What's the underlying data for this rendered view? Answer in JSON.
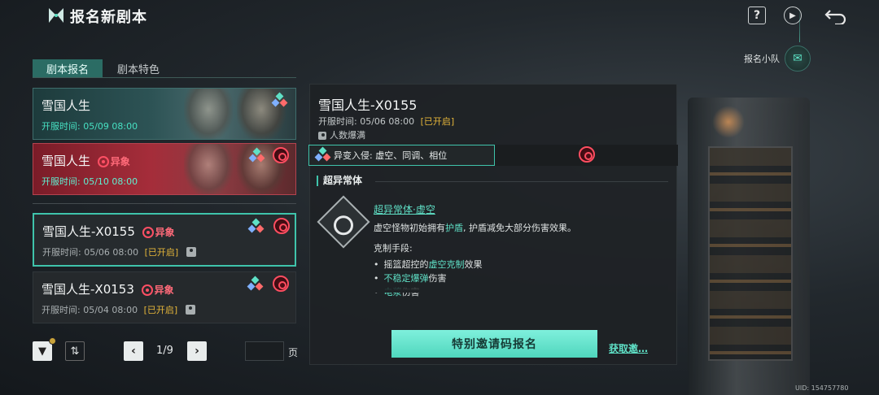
{
  "header": {
    "title": "报名新剧本",
    "help_label": "?",
    "team_label": "报名小队"
  },
  "tabs": [
    {
      "label": "剧本报名",
      "active": true
    },
    {
      "label": "剧本特色",
      "active": false
    }
  ],
  "list": [
    {
      "name": "雪国人生",
      "time": "开服时间: 05/09 08:00",
      "anomaly": "",
      "status": ""
    },
    {
      "name": "雪国人生",
      "time": "开服时间: 05/10 08:00",
      "anomaly": "异象",
      "status": ""
    },
    {
      "name": "雪国人生-X0155",
      "time": "开服时间: 05/06 08:00",
      "anomaly": "异象",
      "status": "[已开启]"
    },
    {
      "name": "雪国人生-X0153",
      "time": "开服时间: 05/04 08:00",
      "anomaly": "异象",
      "status": "[已开启]"
    }
  ],
  "pagination": {
    "indicator": "1/9",
    "page_input": "",
    "unit": "页"
  },
  "detail": {
    "title": "雪国人生-X0155",
    "time": "开服时间: 05/06 08:00",
    "status": "[已开启]",
    "population": "人数爆满",
    "mutation": "异变入侵: 虚空、同调、相位",
    "section_title": "超异常体",
    "ability_name": "超异常体·虚空",
    "ability_desc_pre": "虚空怪物初始拥有",
    "ability_desc_hl": "护盾",
    "ability_desc_post": ", 护盾减免大部分伤害效果。",
    "counter_title": "克制手段:",
    "counter_1_pre": "摇篮超控的",
    "counter_1_hl": "虚空克制",
    "counter_1_post": "效果",
    "counter_2_hl": "不稳定爆弹",
    "counter_2_post": "伤害",
    "counter_3_hl": "电浆",
    "counter_3_post": "伤害",
    "invite_button": "特别邀请码报名",
    "get_invite": "获取邀…"
  },
  "uid": "UID: 154757780",
  "colors": {
    "accent": "#3fc4ab",
    "anomaly": "#ff6a79",
    "status": "#e4b53a"
  }
}
